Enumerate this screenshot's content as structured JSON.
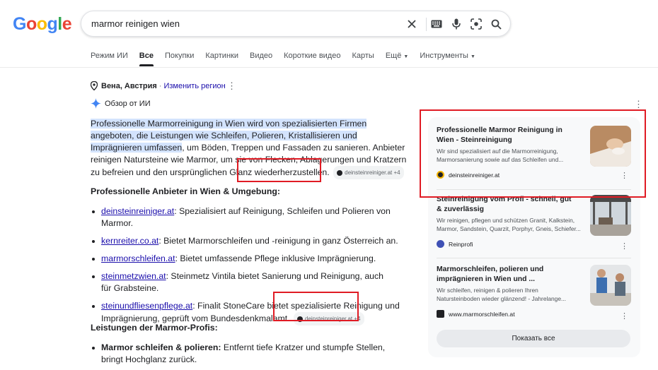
{
  "logo": "Google",
  "search": {
    "query": "marmor reinigen wien"
  },
  "tabs": [
    "Режим ИИ",
    "Все",
    "Покупки",
    "Картинки",
    "Видео",
    "Короткие видео",
    "Карты",
    "Ещё",
    "Инструменты"
  ],
  "location": {
    "city": "Вена, Австрия",
    "separator": "·",
    "change_label": "Изменить регион"
  },
  "ai_overview": {
    "label": "Обзор от ИИ",
    "summary_highlight": "Professionelle Marmorreinigung in Wien wird von spezialisierten Firmen angeboten, die Leistungen wie Schleifen, Polieren, Kristallisieren und Imprägnieren umfassen",
    "summary_rest": ", um Böden, Treppen und Fassaden zu sanieren. Anbieter reinigen Natursteine wie Marmor, um sie von Flecken, Ablagerungen und Kratzern zu befreien und den ursprünglichen Glanz wiederherzustellen.",
    "chip": "deinsteinreiniger.at +4",
    "providers_title": "Professionelle Anbieter in Wien & Umgebung:",
    "providers": [
      {
        "link": "deinsteinreiniger.at",
        "text": ": Spezialisiert auf Reinigung, Schleifen und Polieren von Marmor."
      },
      {
        "link": "kernreiter.co.at",
        "text": ": Bietet Marmorschleifen und -reinigung in ganz Österreich an."
      },
      {
        "link": "marmorschleifen.at",
        "text": ": Bietet umfassende Pflege inklusive Imprägnierung."
      },
      {
        "link": "steinmetzwien.at",
        "text": ": Steinmetz Vintila bietet Sanierung und Reinigung, auch für Grabsteine."
      },
      {
        "link": "steinundfliesenpflege.at",
        "text": ": Finalit StoneCare bietet spezialisierte Reinigung und Imprägnierung, geprüft vom Bundesdenkmalamt."
      }
    ],
    "chip2": "deinsteinreiniger.at +4",
    "services_title": "Leistungen der Marmor-Profis:",
    "services": [
      {
        "bold": "Marmor schleifen & polieren:",
        "text": " Entfernt tiefe Kratzer und stumpfe Stellen, bringt Hochglanz zurück."
      }
    ]
  },
  "side_cards": [
    {
      "title": "Professionelle Marmor Reinigung in Wien - Steinreinigung",
      "desc1": "Wir sind spezialisiert auf die Marmorreinigung,",
      "desc2": "Marmorsanierung sowie auf das Schleifen und...",
      "source": "deinsteinreiniger.at"
    },
    {
      "title": "Steinreinigung vom Profi - schnell, gut & zuverlässig",
      "desc1": "Wir reinigen, pflegen und schützen Granit, Kalkstein,",
      "desc2": "Marmor, Sandstein, Quarzit, Porphyr, Gneis, Schiefer...",
      "source": "Reinprofi"
    },
    {
      "title": "Marmorschleifen, polieren und imprägnieren in Wien und ...",
      "desc1": "Wir schleifen, reinigen & polieren Ihren",
      "desc2": "Natursteinboden wieder glänzend! - Jahrelange...",
      "source": "www.marmorschleifen.at"
    }
  ],
  "show_all_label": "Показать все",
  "colors": {
    "link": "#1a0dab",
    "highlight": "#d3e3fd",
    "annotation_box": "#e01b24"
  }
}
